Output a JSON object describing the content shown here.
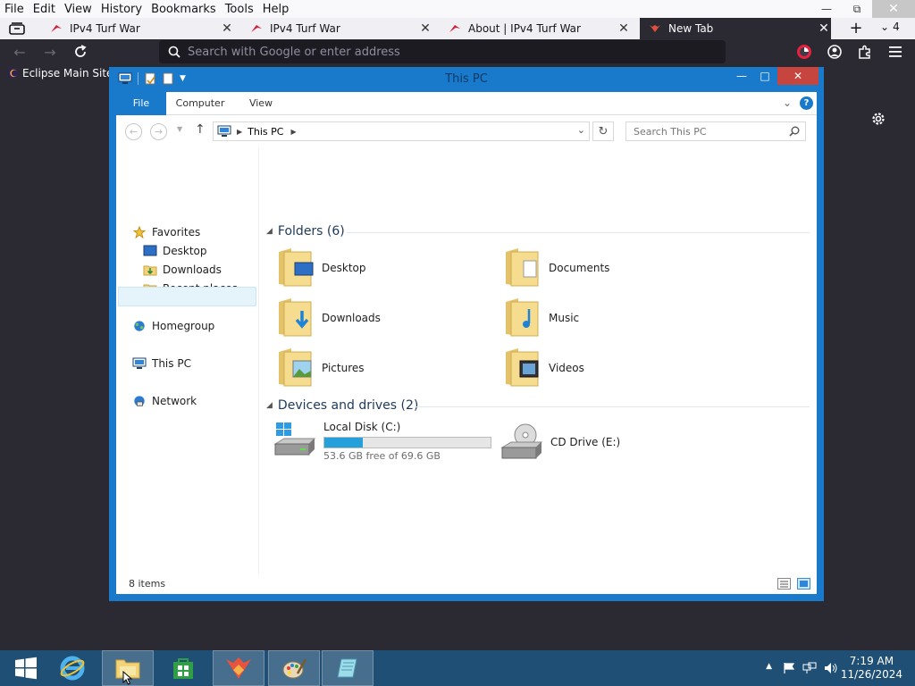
{
  "browser": {
    "menu": [
      "File",
      "Edit",
      "View",
      "History",
      "Bookmarks",
      "Tools",
      "Help"
    ],
    "tabs": [
      {
        "title": "IPv4 Turf War",
        "active": false
      },
      {
        "title": "IPv4 Turf War",
        "active": false
      },
      {
        "title": "About | IPv4 Turf War",
        "active": false
      },
      {
        "title": "New Tab",
        "active": true
      }
    ],
    "tab_count": "4",
    "url_placeholder": "Search with Google or enter address",
    "bookmark": "Eclipse Main Site"
  },
  "explorer": {
    "title": "This PC",
    "ribbon_tabs": [
      "File",
      "Computer",
      "View"
    ],
    "address": "This PC",
    "search_placeholder": "Search This PC",
    "nav": {
      "favorites": "Favorites",
      "desktop": "Desktop",
      "downloads": "Downloads",
      "recent": "Recent places",
      "homegroup": "Homegroup",
      "thispc": "This PC",
      "network": "Network"
    },
    "folders_header": "Folders (6)",
    "folders": [
      "Desktop",
      "Documents",
      "Downloads",
      "Music",
      "Pictures",
      "Videos"
    ],
    "devices_header": "Devices and drives (2)",
    "drives": [
      {
        "name": "Local Disk (C:)",
        "free": "53.6 GB free of 69.6 GB",
        "used_fraction": 0.23
      },
      {
        "name": "CD Drive (E:)"
      }
    ],
    "status": "8 items"
  },
  "taskbar": {
    "time": "7:19 AM",
    "date": "11/26/2024"
  },
  "colors": {
    "explorer_frame": "#1979ca",
    "taskbar": "#1f4f74",
    "browser_dark": "#2b2a33"
  }
}
